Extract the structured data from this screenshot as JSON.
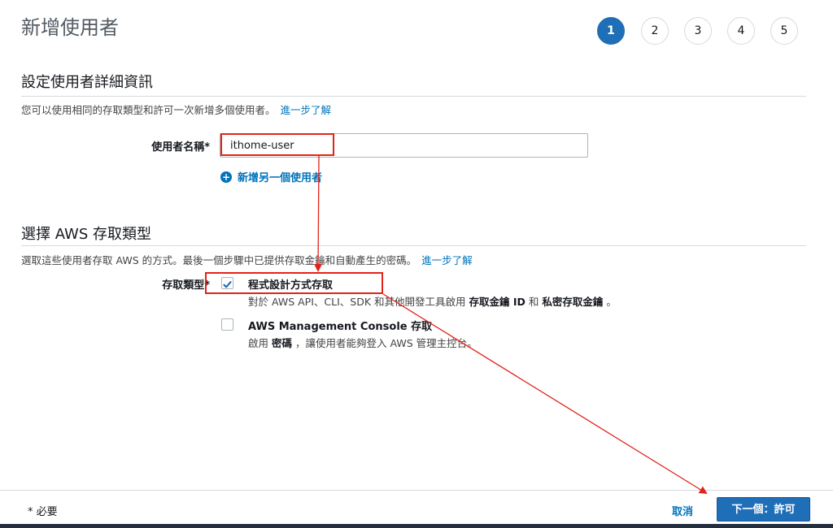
{
  "page": {
    "title": "新增使用者",
    "steps": [
      "1",
      "2",
      "3",
      "4",
      "5"
    ],
    "active_step": "1"
  },
  "user_details": {
    "heading": "設定使用者詳細資訊",
    "description": "您可以使用相同的存取類型和許可一次新增多個使用者。",
    "learn_more": "進一步了解",
    "username_label": "使用者名稱*",
    "username_value": "ithome-user",
    "add_another_user": "新增另一個使用者"
  },
  "access_type": {
    "heading": "選擇 AWS 存取類型",
    "description": "選取這些使用者存取 AWS 的方式。最後一個步驟中已提供存取金鑰和自動產生的密碼。",
    "learn_more": "進一步了解",
    "label": "存取類型*",
    "programmatic": {
      "title": "程式設計方式存取",
      "desc_prefix": "對於 AWS API、CLI、SDK 和其他開發工具啟用",
      "desc_key1": "存取金鑰 ID",
      "desc_mid": "和",
      "desc_key2": "私密存取金鑰",
      "desc_suffix": "。",
      "checked": true
    },
    "console": {
      "title": "AWS Management Console 存取",
      "desc_prefix": "啟用",
      "desc_key": "密碼",
      "desc_suffix": "，讓使用者能夠登入 AWS 管理主控台。",
      "checked": false
    }
  },
  "footer": {
    "required_note": "* 必要",
    "cancel": "取消",
    "next": "下一個：許可"
  },
  "colors": {
    "primary": "#1f6fb8",
    "link": "#0073bb",
    "annotation": "#e2231a"
  }
}
